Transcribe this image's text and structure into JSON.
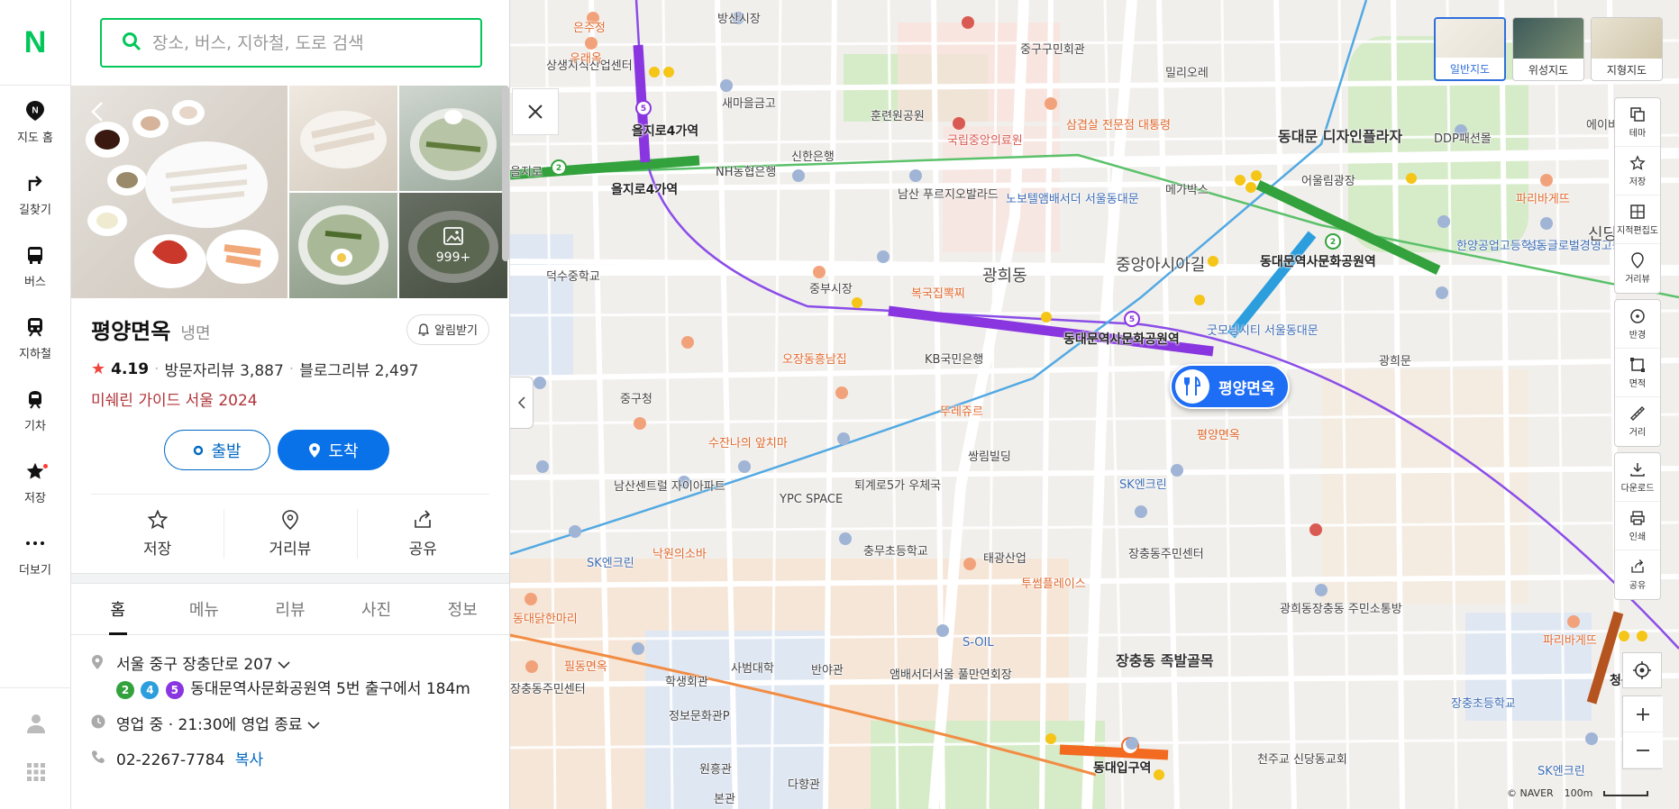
{
  "nav": {
    "logo": "N",
    "items": [
      {
        "label": "지도 홈",
        "icon": "map-home-icon"
      },
      {
        "label": "길찾기",
        "icon": "directions-icon"
      },
      {
        "label": "버스",
        "icon": "bus-icon"
      },
      {
        "label": "지하철",
        "icon": "subway-icon"
      },
      {
        "label": "기차",
        "icon": "train-icon"
      },
      {
        "label": "저장",
        "icon": "star-icon"
      },
      {
        "label": "더보기",
        "icon": "more-icon"
      }
    ]
  },
  "search": {
    "placeholder": "장소, 버스, 지하철, 도로 검색"
  },
  "photos": {
    "more_count": "999+"
  },
  "place": {
    "name": "평양면옥",
    "category": "냉면",
    "alarm_label": "알림받기",
    "rating": "4.19",
    "visitor_reviews": "방문자리뷰 3,887",
    "blog_reviews": "블로그리뷰 2,497",
    "michelin": "미쉐린 가이드 서울 2024",
    "depart_label": "출발",
    "arrive_label": "도착",
    "actions": [
      {
        "label": "저장",
        "icon": "star-icon"
      },
      {
        "label": "거리뷰",
        "icon": "street-view-icon"
      },
      {
        "label": "공유",
        "icon": "share-icon"
      }
    ],
    "tabs": [
      "홈",
      "메뉴",
      "리뷰",
      "사진",
      "정보"
    ],
    "address": "서울 중구 장충단로 207",
    "subway_lines": [
      {
        "num": "2",
        "color": "#33a23d"
      },
      {
        "num": "4",
        "color": "#2c9ede"
      },
      {
        "num": "5",
        "color": "#8936e0"
      }
    ],
    "subway_text": "동대문역사문화공원역 5번 출구에서 184m",
    "hours": "영업 중 · 21:30에 영업 종료",
    "phone": "02-2267-7784",
    "copy_label": "복사"
  },
  "map": {
    "layers": [
      {
        "label": "일반지도",
        "active": true
      },
      {
        "label": "위성지도",
        "active": false
      },
      {
        "label": "지형지도",
        "active": false
      }
    ],
    "tools": [
      "테마",
      "저장",
      "지적편집도",
      "거리뷰",
      "반경",
      "면적",
      "거리",
      "다운로드",
      "인쇄",
      "공유"
    ],
    "pin_label": "평양면옥",
    "pin_sub": "평양면옥",
    "copyright": "© NAVER",
    "scale": "100m",
    "labels": {
      "l1": "상생지식산업센터",
      "l2": "방산시장",
      "l3": "새마을금고",
      "l4": "훈련원공원",
      "l5": "중구구민회관",
      "l6": "국립중앙의료원",
      "l7": "삼겹살 전문점 대통령",
      "l8": "밀리오레",
      "l9": "동대문 디자인플라자",
      "l10": "DDP패션몰",
      "l11": "을지로4가역",
      "l12": "을지로4가역",
      "l13": "NH농협은행",
      "l14": "신한은행",
      "l15": "남산 푸르지오발라드",
      "l16": "노보텔앰배서더 서울동대문",
      "l17": "메가박스",
      "l18": "어울림광장",
      "l19": "파리바게뜨",
      "l20": "한양공업고등학교",
      "l21": "성동글로벌경영고등학교",
      "l22": "광희동",
      "l23": "중앙아시아길",
      "l24": "동대문역사문화공원역",
      "l25": "덕수중학교",
      "l26": "중부시장",
      "l27": "복국집뽁찌",
      "l28": "오장동흥남집",
      "l29": "KB국민은행",
      "l30": "동대문역사문화공원역",
      "l31": "굿모닝시티 서울동대문",
      "l32": "광희문",
      "l33": "중구청",
      "l34": "뚜레쥬르",
      "l35": "수잔나의 앞치마",
      "l36": "쌍림빌딩",
      "l37": "SK엔크린",
      "l38": "남산센트럴 자이아파트",
      "l39": "YPC SPACE",
      "l40": "퇴계로5가 우체국",
      "l41": "장충동주민센터",
      "l42": "낙원의소바",
      "l43": "충무초등학교",
      "l44": "태광산업",
      "l45": "SK엔크린",
      "l46": "투썸플레이스",
      "l47": "광희동장충동 주민소통방",
      "l48": "동대닭한마리",
      "l49": "S-OIL",
      "l50": "필동면옥",
      "l51": "학생회관",
      "l52": "사범대학",
      "l53": "반야관",
      "l54": "앰배서더서울 풀만연회장",
      "l55": "장충동 족발골목",
      "l56": "정보문화관P",
      "l57": "원흥관",
      "l58": "다향관",
      "l59": "본관",
      "l60": "동대입구역",
      "l61": "천주교 신당동교회",
      "l62": "장충초등학교",
      "l63": "우래옥",
      "l64": "은주정",
      "l65": "을지로",
      "l66": "에이비",
      "l67": "신당",
      "l68": "파리바게뜨",
      "l69": "SK엔크린",
      "l70": "청구",
      "l71": "장충동주민센터"
    }
  }
}
